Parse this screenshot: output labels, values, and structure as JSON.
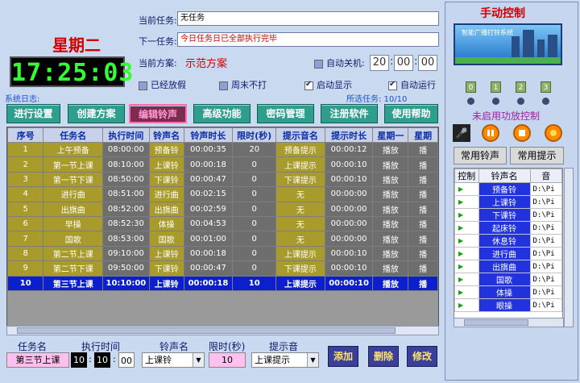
{
  "header": {
    "weekday": "星期二",
    "clock": "17:25:03",
    "current_task_label": "当前任务:",
    "current_task": "无任务",
    "next_task_label": "下一任务:",
    "next_task": "今日任务日已全部执行完毕",
    "plan_label": "当前方案:",
    "plan_value": "示范方案",
    "auto_shutdown_label": "自动关机:",
    "shutdown_time": {
      "h": "20",
      "m": "00",
      "s": "00"
    }
  },
  "options": {
    "holiday": "已经放假",
    "weekend": "周末不打",
    "startup": "启动显示",
    "autorun": "自动运行"
  },
  "log_label": "系统日志:",
  "selected_tasks": "所选任务: 10/10",
  "toolbar": [
    "进行设置",
    "创建方案",
    "编辑铃声",
    "高级功能",
    "密码管理",
    "注册软件",
    "使用帮助"
  ],
  "table": {
    "columns": [
      "序号",
      "任务名",
      "执行时间",
      "铃声名",
      "铃声时长",
      "限时(秒)",
      "提示音名",
      "提示时长",
      "星期一",
      "星期"
    ],
    "rows": [
      [
        "1",
        "上午预备",
        "08:00:00",
        "预备铃",
        "00:00:35",
        "20",
        "预备提示",
        "00:00:12",
        "播放",
        "播"
      ],
      [
        "2",
        "第一节上课",
        "08:10:00",
        "上课铃",
        "00:00:18",
        "0",
        "上课提示",
        "00:00:10",
        "播放",
        "播"
      ],
      [
        "3",
        "第一节下课",
        "08:50:00",
        "下课铃",
        "00:00:47",
        "0",
        "下课提示",
        "00:00:10",
        "播放",
        "播"
      ],
      [
        "4",
        "进行曲",
        "08:51:00",
        "进行曲",
        "00:02:15",
        "0",
        "无",
        "00:00:00",
        "播放",
        "播"
      ],
      [
        "5",
        "出旗曲",
        "08:52:00",
        "出旗曲",
        "00:02:59",
        "0",
        "无",
        "00:00:00",
        "播放",
        "播"
      ],
      [
        "6",
        "早操",
        "08:52:30",
        "体操",
        "00:04:53",
        "0",
        "无",
        "00:00:00",
        "播放",
        "播"
      ],
      [
        "7",
        "国歌",
        "08:53:00",
        "国歌",
        "00:01:00",
        "0",
        "无",
        "00:00:00",
        "播放",
        "播"
      ],
      [
        "8",
        "第二节上课",
        "09:10:00",
        "上课铃",
        "00:00:18",
        "0",
        "上课提示",
        "00:00:10",
        "播放",
        "播"
      ],
      [
        "9",
        "第二节下课",
        "09:50:00",
        "下课铃",
        "00:00:47",
        "0",
        "下课提示",
        "00:00:10",
        "播放",
        "播"
      ],
      [
        "10",
        "第三节上课",
        "10:10:00",
        "上课铃",
        "00:00:18",
        "10",
        "上课提示",
        "00:00:10",
        "播放",
        "播"
      ]
    ]
  },
  "form": {
    "name_label": "任务名",
    "time_label": "执行时间",
    "ring_label": "铃声名",
    "limit_label": "限时(秒)",
    "prompt_label": "提示音",
    "name_value": "第三节上课",
    "time_h": "10",
    "time_m": "10",
    "time_s": "00",
    "ring_value": "上课铃",
    "limit_value": "10",
    "prompt_value": "上课提示",
    "add": "添加",
    "delete": "删除",
    "modify": "修改"
  },
  "right_panel": {
    "title": "手动控制",
    "banner_text": "智能广播打铃系统",
    "channels": [
      "0",
      "1",
      "2",
      "3"
    ],
    "amp_status": "未启用功放控制",
    "common_rings": "常用铃声",
    "common_prompts": "常用提示",
    "list_columns": [
      "控制",
      "铃声名",
      "音"
    ],
    "ring_list": [
      "预备铃",
      "上课铃",
      "下课铃",
      "起床铃",
      "休息铃",
      "进行曲",
      "出旗曲",
      "国歌",
      "体操",
      "眼操"
    ],
    "path_prefix": "D:\\Pi"
  }
}
